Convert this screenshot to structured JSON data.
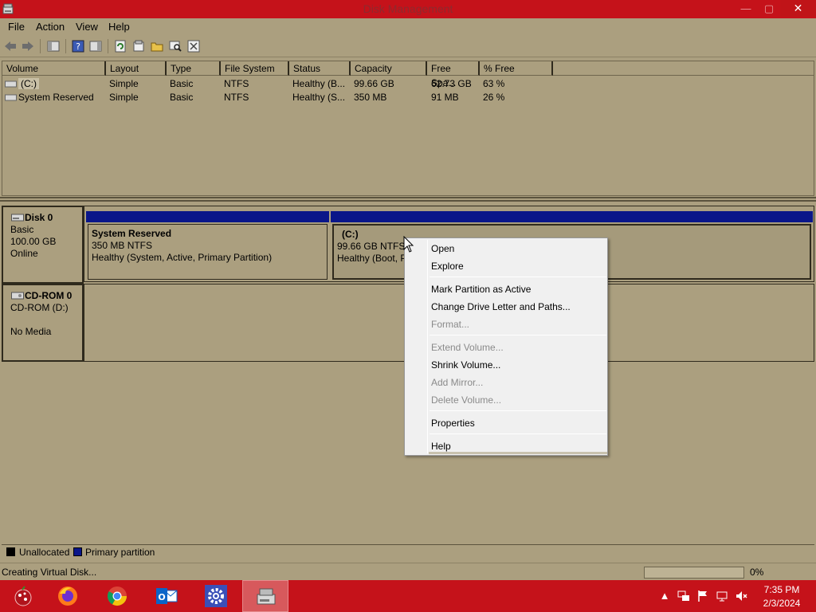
{
  "window": {
    "title": "Disk Management",
    "minimize": "—",
    "maximize": "▢",
    "close": "✕"
  },
  "menu": {
    "items": [
      "File",
      "Action",
      "View",
      "Help"
    ]
  },
  "toolbar": {
    "buttons": [
      "back-arrow-icon",
      "forward-arrow-icon",
      "console-tree-icon",
      "help-icon",
      "action-pane-icon",
      "refresh-icon",
      "properties-icon",
      "open-folder-icon",
      "explore-icon",
      "settings-icon"
    ]
  },
  "volumes": {
    "columns": [
      "Volume",
      "Layout",
      "Type",
      "File System",
      "Status",
      "Capacity",
      "Free Spa...",
      "% Free"
    ],
    "rows": [
      {
        "volume": "(C:)",
        "layout": "Simple",
        "type": "Basic",
        "fs": "NTFS",
        "status": "Healthy (B...",
        "capacity": "99.66 GB",
        "free": "62.73 GB",
        "pct": "63 %"
      },
      {
        "volume": "System Reserved",
        "layout": "Simple",
        "type": "Basic",
        "fs": "NTFS",
        "status": "Healthy (S...",
        "capacity": "350 MB",
        "free": "91 MB",
        "pct": "26 %"
      }
    ]
  },
  "disks": {
    "disk0": {
      "name": "Disk 0",
      "type": "Basic",
      "size": "100.00 GB",
      "status": "Online"
    },
    "cdrom0": {
      "name": "CD-ROM 0",
      "drive": "CD-ROM (D:)",
      "media": "No Media"
    },
    "partitions": [
      {
        "name": "System Reserved",
        "size": "350 MB NTFS",
        "status": "Healthy (System, Active, Primary Partition)"
      },
      {
        "name": "(C:)",
        "size": "99.66 GB NTFS",
        "status": "Healthy (Boot, P"
      }
    ]
  },
  "legend": {
    "unallocated": "Unallocated",
    "primary": "Primary partition",
    "unallocated_color": "#000000",
    "primary_color": "#0a1689"
  },
  "status": {
    "message": "Creating Virtual Disk...",
    "progress_percent": "0%"
  },
  "context_menu": {
    "items": [
      {
        "label": "Open",
        "enabled": true
      },
      {
        "label": "Explore",
        "enabled": true
      },
      {
        "label": "Mark Partition as Active",
        "enabled": true
      },
      {
        "label": "Change Drive Letter and Paths...",
        "enabled": true
      },
      {
        "label": "Format...",
        "enabled": false
      },
      {
        "label": "Extend Volume...",
        "enabled": false
      },
      {
        "label": "Shrink Volume...",
        "enabled": true
      },
      {
        "label": "Add Mirror...",
        "enabled": false
      },
      {
        "label": "Delete Volume...",
        "enabled": false
      },
      {
        "label": "Properties",
        "enabled": true
      },
      {
        "label": "Help",
        "enabled": true
      }
    ]
  },
  "taskbar": {
    "apps": [
      "start-icon",
      "firefox-icon",
      "chrome-icon",
      "outlook-icon",
      "settings-icon",
      "disk-management-icon"
    ],
    "clock_time": "7:35 PM",
    "clock_date": "2/3/2024",
    "accent": "#c5121a"
  }
}
